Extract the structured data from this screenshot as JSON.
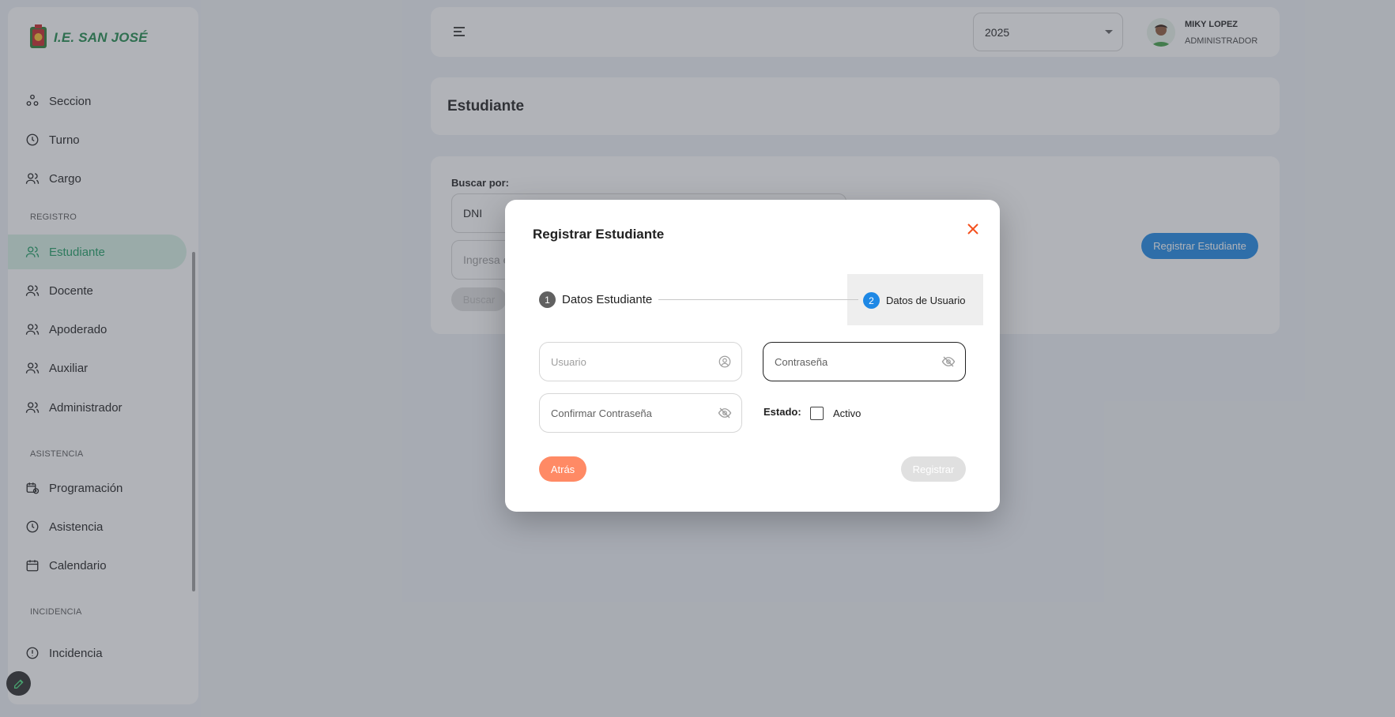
{
  "brand": {
    "name": "I.E. SAN JOSÉ"
  },
  "sidebar": {
    "items": [
      {
        "label": "Seccion",
        "icon": "sections-icon",
        "active": false
      },
      {
        "label": "Turno",
        "icon": "clock-icon",
        "active": false
      },
      {
        "label": "Cargo",
        "icon": "users-icon",
        "active": false
      }
    ],
    "section_registro": "REGISTRO",
    "registro_items": [
      {
        "label": "Estudiante",
        "icon": "users-icon",
        "active": true
      },
      {
        "label": "Docente",
        "icon": "users-icon",
        "active": false
      },
      {
        "label": "Apoderado",
        "icon": "users-icon",
        "active": false
      },
      {
        "label": "Auxiliar",
        "icon": "users-icon",
        "active": false
      },
      {
        "label": "Administrador",
        "icon": "users-icon",
        "active": false
      }
    ],
    "section_asistencia": "ASISTENCIA",
    "asistencia_items": [
      {
        "label": "Programación",
        "icon": "calendar-clock-icon",
        "active": false
      },
      {
        "label": "Asistencia",
        "icon": "clock-icon",
        "active": false
      },
      {
        "label": "Calendario",
        "icon": "calendar-icon",
        "active": false
      }
    ],
    "section_incidencia": "INCIDENCIA",
    "incidencia_items": [
      {
        "label": "Incidencia",
        "icon": "alert-icon",
        "active": false
      }
    ]
  },
  "header": {
    "year": "2025",
    "user_name": "MIKY LOPEZ",
    "user_role": "ADMINISTRADOR"
  },
  "page": {
    "title": "Estudiante"
  },
  "search": {
    "label": "Buscar por:",
    "type_value": "DNI",
    "input_placeholder": "Ingresa e",
    "search_button": "Buscar",
    "register_button": "Registrar Estudiante"
  },
  "modal": {
    "title": "Registrar Estudiante",
    "steps": [
      {
        "number": "1",
        "label": "Datos Estudiante"
      },
      {
        "number": "2",
        "label": "Datos de Usuario"
      }
    ],
    "fields": {
      "usuario_placeholder": "Usuario",
      "password_placeholder": "Contraseña",
      "confirm_placeholder": "Confirmar Contraseña"
    },
    "estado_label": "Estado:",
    "estado_option": "Activo",
    "estado_checked": false,
    "back_button": "Atrás",
    "submit_button": "Registrar"
  },
  "colors": {
    "brand_green": "#1f8a4c",
    "active_bg": "#d8f2e6",
    "primary_blue": "#1e88e5",
    "back_orange": "#ff8a65",
    "close_red": "#f4511e"
  }
}
